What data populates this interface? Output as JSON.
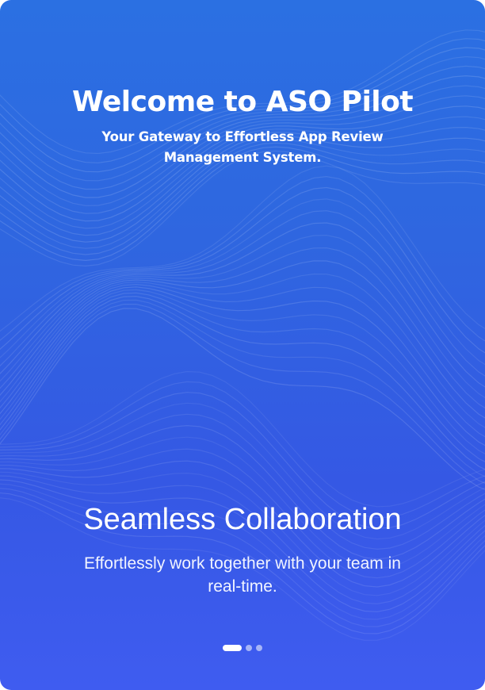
{
  "header": {
    "title": "Welcome to ASO Pilot",
    "subtitle": "Your Gateway to Effortless App Review Management System."
  },
  "slide": {
    "title": "Seamless Collaboration",
    "description": "Effortlessly work together with your team in real-time."
  },
  "pagination": {
    "total": 3,
    "active_index": 0
  },
  "colors": {
    "background_top": "#2b70e2",
    "background_bottom": "#3f5cf0",
    "text": "#ffffff"
  }
}
